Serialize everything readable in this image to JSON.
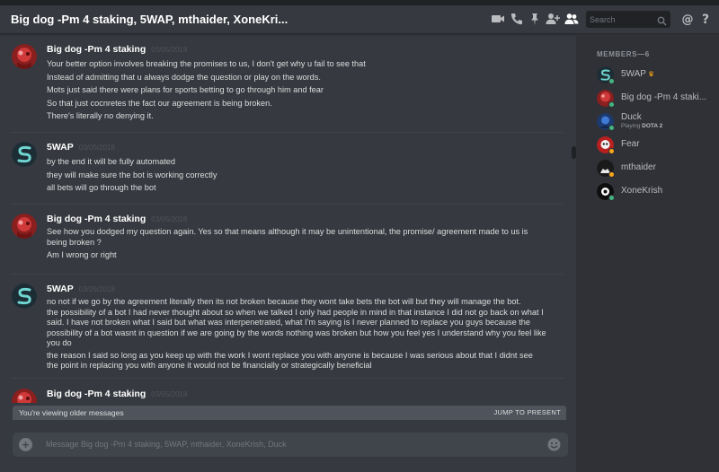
{
  "header": {
    "title": "Big dog -Pm 4 staking, 5WAP, mthaider, XoneKri...",
    "search_placeholder": "Search"
  },
  "colors": {
    "background": "#36393f",
    "sidebar": "#2f3136",
    "online": "#43b581",
    "idle": "#faa61a"
  },
  "messages": [
    {
      "author": "Big dog -Pm 4 staking",
      "timestamp": "03/05/2018",
      "lines": [
        "Your better option involves breaking the promises to us, I don't get why u fail to see that",
        "Instead of admitting that u always dodge the question or play on the words.",
        "Mots just said there were plans for sports betting to go through him and fear",
        "So that just cocnretes the fact our agreement is being broken.",
        "There's literally no denying it."
      ]
    },
    {
      "author": "5WAP",
      "timestamp": "03/05/2018",
      "lines": [
        "by the end it will be fully automated",
        "they will make sure the bot is working correctly",
        "all bets will go through the bot"
      ]
    },
    {
      "author": "Big dog -Pm 4 staking",
      "timestamp": "03/05/2018",
      "lines": [
        "See how you dodged my question again. Yes so that means although it may be unintentional, the promise/ agreement made to us is",
        "being broken ?",
        "Am I wrong or right"
      ]
    },
    {
      "author": "5WAP",
      "timestamp": "03/05/2018",
      "lines": [
        "no not if we go by the agreement literally then its not broken because they wont take bets the bot will but they will manage the bot.",
        "the possibility of a bot I had never thought about so when we talked I only had people in mind in that instance I did not go back on what I",
        "said. I have not broken what I said but what was interpenetrated, what I'm saying is I never planned to replace you guys because the",
        "possibility of a bot wasnt  in question if we are going by the words nothing was broken but how you feel yes I understand why you feel like",
        "you do",
        "the reason I said so long as you keep up with the work I wont replace you with anyone is because I was serious about that I didnt see",
        "the point in replacing you with anyone it would not be financially or strategically beneficial"
      ]
    },
    {
      "author": "Big dog -Pm 4 staking",
      "timestamp": "03/05/2018",
      "lines": []
    }
  ],
  "older_banner": {
    "text": "You're viewing older messages",
    "jump": "JUMP TO PRESENT"
  },
  "composer": {
    "placeholder": "Message Big dog -Pm 4 staking, 5WAP, mthaider, XoneKrish, Duck"
  },
  "members": {
    "heading": "MEMBERS—6",
    "list": [
      {
        "name": "5WAP",
        "status": "online",
        "crown": true
      },
      {
        "name": "Big dog -Pm 4 staki...",
        "status": "online"
      },
      {
        "name": "Duck",
        "status": "online",
        "activity_prefix": "Playing",
        "activity": "DOTA 2"
      },
      {
        "name": "Fear",
        "status": "idle"
      },
      {
        "name": "mthaider",
        "status": "idle"
      },
      {
        "name": "XoneKrish",
        "status": "online"
      }
    ]
  },
  "icons": [
    "video-call-icon",
    "phone-icon",
    "pin-icon",
    "add-member-icon",
    "members-icon",
    "search-icon",
    "mention-icon",
    "help-icon",
    "add-attachment-icon",
    "emoji-icon"
  ]
}
